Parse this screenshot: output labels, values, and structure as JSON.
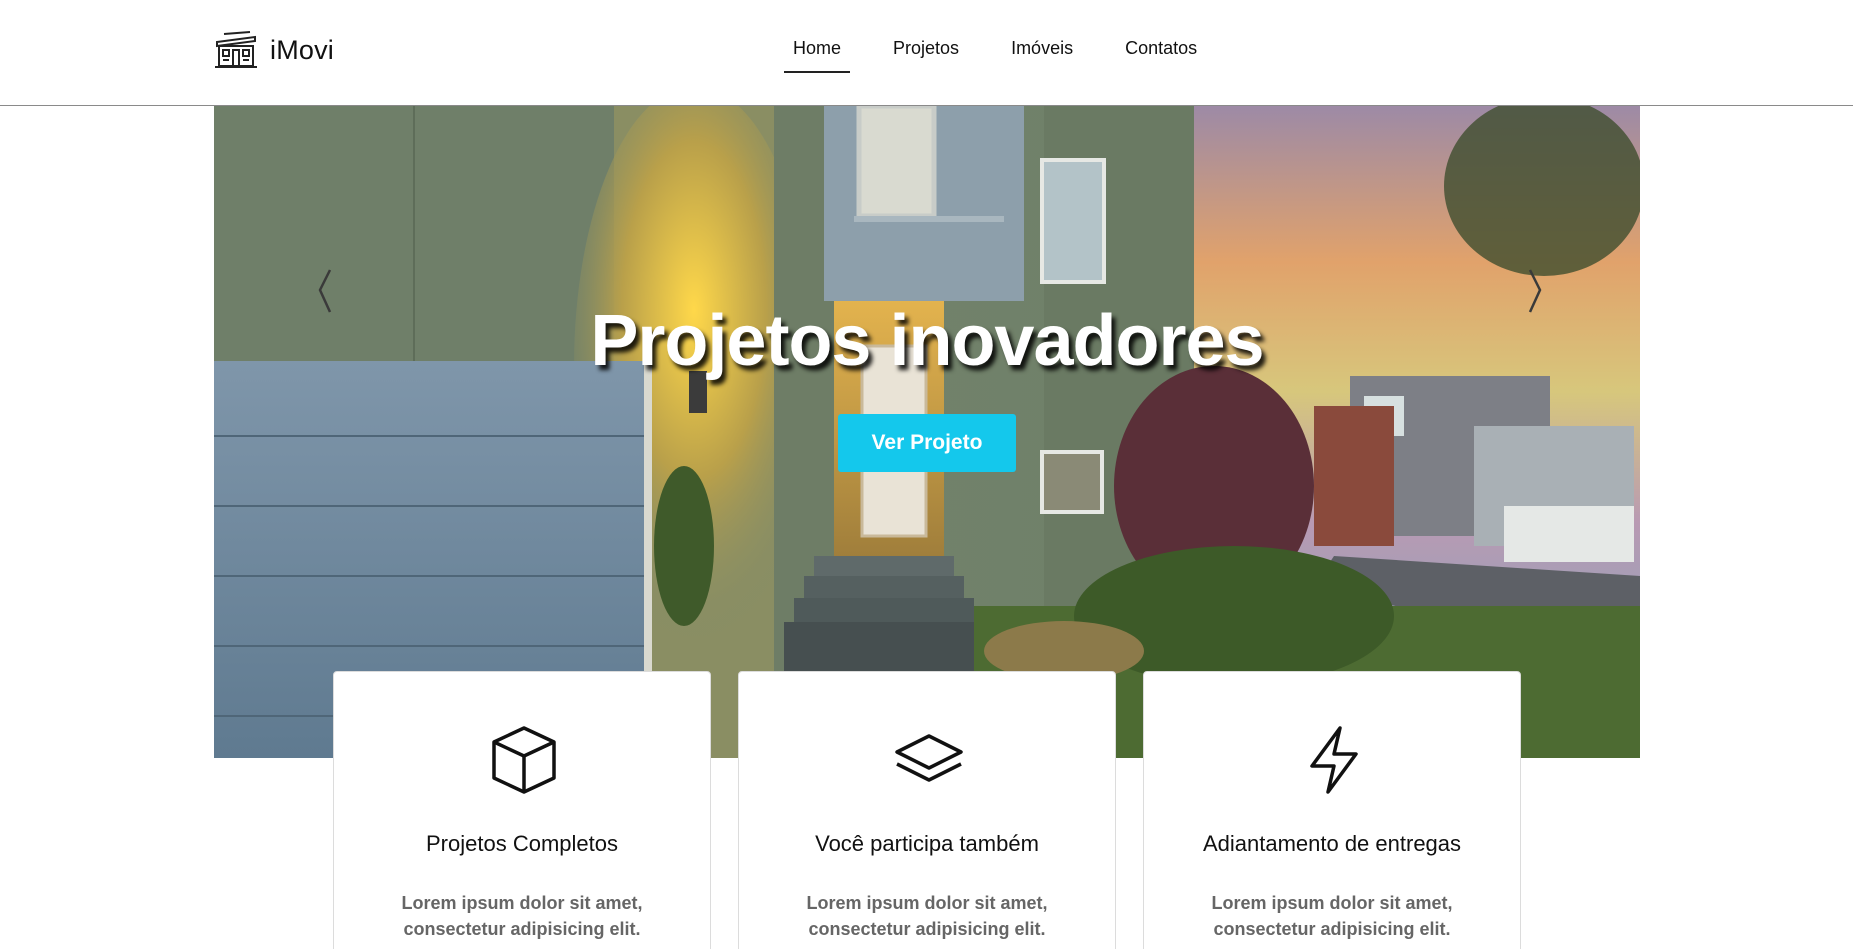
{
  "header": {
    "brand_name": "iMovi",
    "logo_icon": "building-icon",
    "nav": [
      {
        "label": "Home",
        "active": true
      },
      {
        "label": "Projetos",
        "active": false
      },
      {
        "label": "Imóveis",
        "active": false
      },
      {
        "label": "Contatos",
        "active": false
      }
    ]
  },
  "hero": {
    "title": "Projetos inovadores",
    "button_label": "Ver Projeto",
    "button_color": "#14c8ec",
    "prev_icon": "chevron-left-icon",
    "next_icon": "chevron-right-icon"
  },
  "features": [
    {
      "icon": "box-icon",
      "title": "Projetos Completos",
      "text": "Lorem ipsum dolor sit amet, consectetur adipisicing elit."
    },
    {
      "icon": "layers-icon",
      "title": "Você participa também",
      "text": "Lorem ipsum dolor sit amet, consectetur adipisicing elit."
    },
    {
      "icon": "lightning-icon",
      "title": "Adiantamento de entregas",
      "text": "Lorem ipsum dolor sit amet, consectetur adipisicing elit."
    }
  ]
}
